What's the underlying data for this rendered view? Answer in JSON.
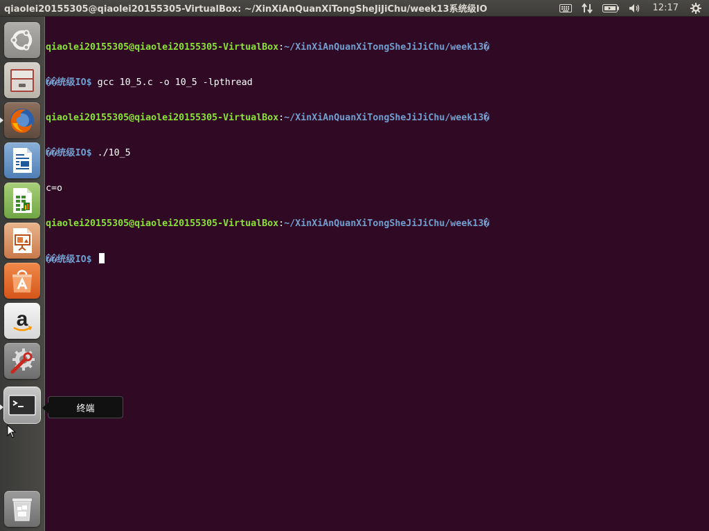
{
  "panel": {
    "window_title": "qiaolei20155305@qiaolei20155305-VirtualBox: ~/XinXiAnQuanXiTongSheJiJiChu/week13系统级IO",
    "clock": "12:17",
    "icons": [
      "keyboard-icon",
      "network-icon",
      "battery-icon",
      "volume-icon",
      "settings-gear-icon"
    ]
  },
  "launcher": {
    "items": [
      {
        "name": "dash-home",
        "icon": "ubuntu-logo-icon"
      },
      {
        "name": "files",
        "icon": "file-cabinet-icon"
      },
      {
        "name": "firefox",
        "icon": "firefox-icon"
      },
      {
        "name": "libreoffice-writer",
        "icon": "writer-document-icon"
      },
      {
        "name": "libreoffice-calc",
        "icon": "calc-spreadsheet-icon"
      },
      {
        "name": "libreoffice-impress",
        "icon": "impress-presentation-icon"
      },
      {
        "name": "ubuntu-software",
        "icon": "shopping-bag-icon"
      },
      {
        "name": "amazon",
        "icon": "amazon-icon"
      },
      {
        "name": "system-settings",
        "icon": "wrench-gear-icon"
      },
      {
        "name": "terminal",
        "icon": "terminal-icon"
      },
      {
        "name": "trash",
        "icon": "trash-icon"
      }
    ],
    "tooltip": "终端"
  },
  "terminal": {
    "lines": [
      {
        "user": "qiaolei20155305@qiaolei20155305-VirtualBox",
        "sep": ":",
        "path": "~/XinXiAnQuanXiTongSheJiJiChu/week13�"
      },
      {
        "prompt_cont": "��统级IO$ ",
        "cmd": "gcc 10_5.c -o 10_5 -lpthread"
      },
      {
        "user": "qiaolei20155305@qiaolei20155305-VirtualBox",
        "sep": ":",
        "path": "~/XinXiAnQuanXiTongSheJiJiChu/week13�"
      },
      {
        "prompt_cont": "��统级IO$ ",
        "cmd": "./10_5"
      },
      {
        "output": "c=o"
      },
      {
        "user": "qiaolei20155305@qiaolei20155305-VirtualBox",
        "sep": ":",
        "path": "~/XinXiAnQuanXiTongSheJiJiChu/week13�"
      },
      {
        "prompt_cont": "��统级IO$ ",
        "cmd": ""
      }
    ]
  },
  "colors": {
    "terminal_bg": "#300a24",
    "user_host": "#8ae234",
    "path": "#729fcf",
    "text": "#ffffff"
  }
}
